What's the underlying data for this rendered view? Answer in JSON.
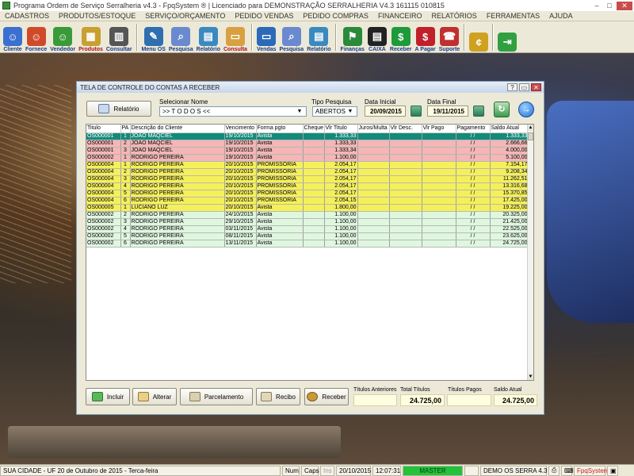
{
  "window": {
    "title": "Programa Ordem de Serviço Serralheria v4.3 - FpqSystem ® | Licenciado para  DEMONSTRAÇÃO SERRALHERIA V4.3 161115 010815"
  },
  "menu": [
    "CADASTROS",
    "PRODUTOS/ESTOQUE",
    "SERVIÇO/ORÇAMENTO",
    "PEDIDO VENDAS",
    "PEDIDO COMPRAS",
    "FINANCEIRO",
    "RELATÓRIOS",
    "FERRAMENTAS",
    "AJUDA"
  ],
  "toolbar": [
    {
      "label": "Cliente",
      "icon": "client-icon",
      "color": "#3b6fd0"
    },
    {
      "label": "Fornece",
      "icon": "supplier-icon",
      "color": "#d04a2a"
    },
    {
      "label": "Vendedor",
      "icon": "seller-icon",
      "color": "#3a9a3a"
    },
    {
      "label": "Produtos",
      "icon": "boxes-icon",
      "color": "#c8a030"
    },
    {
      "label": "Consultar",
      "icon": "barcode-icon",
      "color": "#555555"
    },
    {
      "label": "Menu OS",
      "icon": "clipboard-icon",
      "color": "#2f6fb0"
    },
    {
      "label": "Pesquisa",
      "icon": "search-doc-icon",
      "color": "#6a8ad0"
    },
    {
      "label": "Relatório",
      "icon": "report-icon",
      "color": "#3a8ac0"
    },
    {
      "label": "Consulta",
      "icon": "folder-icon",
      "color": "#d8a040"
    },
    {
      "label": "Vendas",
      "icon": "monitor-icon",
      "color": "#2a6ab8"
    },
    {
      "label": "Pesquisa",
      "icon": "search-doc-icon",
      "color": "#6a8ad0"
    },
    {
      "label": "Relatório",
      "icon": "report-icon",
      "color": "#3a8ac0"
    },
    {
      "label": "Finanças",
      "icon": "flags-icon",
      "color": "#2a8a3a"
    },
    {
      "label": "CAIXA",
      "icon": "cash-book-icon",
      "color": "#222222"
    },
    {
      "label": "Receber",
      "icon": "dollar-green-icon",
      "color": "#1f9a3a"
    },
    {
      "label": "A Pagar",
      "icon": "dollar-red-icon",
      "color": "#c0202a"
    },
    {
      "label": "Suporte",
      "icon": "support-icon",
      "color": "#c03030"
    },
    {
      "label": "",
      "icon": "coin-icon",
      "color": "#d0a020"
    },
    {
      "label": "",
      "icon": "exit-icon",
      "color": "#30a040"
    }
  ],
  "dialog": {
    "title": "TELA DE CONTROLE DO CONTAS A RECEBER",
    "report_button": "Relatório",
    "select_name_label": "Selecionar Nome",
    "select_name_value": ">> T O D O S <<",
    "tipo_label": "Tipo  Pesquisa",
    "tipo_value": "ABERTOS",
    "data_inicial_label": "Data Inicial",
    "data_inicial": "20/09/2015",
    "data_final_label": "Data Final",
    "data_final": "19/11/2015"
  },
  "grid": {
    "columns": [
      "Titulo",
      "PA",
      "Descrição do Cliente",
      "Vencimento",
      "Forma pgto",
      "Cheque",
      "Vlr Titulo",
      "Juros/Multa",
      "Vlr Desc.",
      "Vlr Pago",
      "Pagamento",
      "Saldo Atual"
    ],
    "rows": [
      {
        "style": "sel",
        "cells": [
          "OS000001",
          "1",
          "JOÃO MAQCIEL",
          "19/10/2015",
          "Avista",
          "",
          "1.333,33",
          "",
          "",
          "",
          "/ /",
          "1.333,33"
        ]
      },
      {
        "style": "r-pink",
        "cells": [
          "OS000001",
          "2",
          "JOÃO MAQCIEL",
          "19/10/2015",
          "Avista",
          "",
          "1.333,33",
          "",
          "",
          "",
          "/ /",
          "2.666,66"
        ]
      },
      {
        "style": "r-pink",
        "cells": [
          "OS000001",
          "3",
          "JOÃO MAQCIEL",
          "19/10/2015",
          "Avista",
          "",
          "1.333,34",
          "",
          "",
          "",
          "/ /",
          "4.000,00"
        ]
      },
      {
        "style": "r-pink",
        "cells": [
          "OS000002",
          "1",
          "RODRIGO PEREIRA",
          "19/10/2015",
          "Avista",
          "",
          "1.100,00",
          "",
          "",
          "",
          "/ /",
          "5.100,00"
        ]
      },
      {
        "style": "r-yellow",
        "cells": [
          "OS000004",
          "1",
          "RODRIGO PEREIRA",
          "20/10/2015",
          "PROMISSÓRIA",
          "",
          "2.054,17",
          "",
          "",
          "",
          "/ /",
          "7.154,17"
        ]
      },
      {
        "style": "r-yellow",
        "cells": [
          "OS000004",
          "2",
          "RODRIGO PEREIRA",
          "20/10/2015",
          "PROMISSÓRIA",
          "",
          "2.054,17",
          "",
          "",
          "",
          "/ /",
          "9.208,34"
        ]
      },
      {
        "style": "r-yellow",
        "cells": [
          "OS000004",
          "3",
          "RODRIGO PEREIRA",
          "20/10/2015",
          "PROMISSÓRIA",
          "",
          "2.054,17",
          "",
          "",
          "",
          "/ /",
          "11.262,51"
        ]
      },
      {
        "style": "r-yellow",
        "cells": [
          "OS000004",
          "4",
          "RODRIGO PEREIRA",
          "20/10/2015",
          "PROMISSÓRIA",
          "",
          "2.054,17",
          "",
          "",
          "",
          "/ /",
          "13.316,68"
        ]
      },
      {
        "style": "r-yellow",
        "cells": [
          "OS000004",
          "5",
          "RODRIGO PEREIRA",
          "20/10/2015",
          "PROMISSÓRIA",
          "",
          "2.054,17",
          "",
          "",
          "",
          "/ /",
          "15.370,85"
        ]
      },
      {
        "style": "r-yellow",
        "cells": [
          "OS000004",
          "6",
          "RODRIGO PEREIRA",
          "20/10/2015",
          "PROMISSÓRIA",
          "",
          "2.054,15",
          "",
          "",
          "",
          "/ /",
          "17.425,00"
        ]
      },
      {
        "style": "r-yellow",
        "cells": [
          "OS000005",
          "1",
          "LUCIANO LUZ",
          "20/10/2015",
          "Avista",
          "",
          "1.800,00",
          "",
          "",
          "",
          "/ /",
          "19.225,00"
        ]
      },
      {
        "style": "r-green",
        "cells": [
          "OS000002",
          "2",
          "RODRIGO PEREIRA",
          "24/10/2015",
          "Avista",
          "",
          "1.100,00",
          "",
          "",
          "",
          "/ /",
          "20.325,00"
        ]
      },
      {
        "style": "r-green",
        "cells": [
          "OS000002",
          "3",
          "RODRIGO PEREIRA",
          "29/10/2015",
          "Avista",
          "",
          "1.100,00",
          "",
          "",
          "",
          "/ /",
          "21.425,00"
        ]
      },
      {
        "style": "r-green",
        "cells": [
          "OS000002",
          "4",
          "RODRIGO PEREIRA",
          "03/11/2015",
          "Avista",
          "",
          "1.100,00",
          "",
          "",
          "",
          "/ /",
          "22.525,00"
        ]
      },
      {
        "style": "r-green",
        "cells": [
          "OS000002",
          "5",
          "RODRIGO PEREIRA",
          "08/11/2015",
          "Avista",
          "",
          "1.100,00",
          "",
          "",
          "",
          "/ /",
          "23.625,00"
        ]
      },
      {
        "style": "r-green",
        "cells": [
          "OS000002",
          "6",
          "RODRIGO PEREIRA",
          "13/11/2015",
          "Avista",
          "",
          "1.100,00",
          "",
          "",
          "",
          "/ /",
          "24.725,00"
        ]
      }
    ]
  },
  "actions": {
    "incluir": "Incluir",
    "alterar": "Alterar",
    "parcelamento": "Parcelamento",
    "recibo": "Recibo",
    "receber": "Receber"
  },
  "totals": {
    "anteriores_label": "Títulos Anteriores",
    "anteriores": "",
    "total_label": "Total Títulos",
    "total": "24.725,00",
    "pagos_label": "Títulos Pagos",
    "pagos": "",
    "saldo_label": "Saldo Atual",
    "saldo": "24.725,00"
  },
  "status": {
    "city": "SUA CIDADE - UF 20 de Outubro de 2015 - Terca-feira",
    "num": "Num",
    "caps": "Caps",
    "ins": "Ins",
    "date": "20/10/2015",
    "time": "12:07:31",
    "master": "MASTER",
    "version": "DEMO OS SERRA 4.3",
    "brand": "FpqSystem"
  },
  "colors": {
    "selected_row": "#138a7a",
    "pink_row": "#f4b6b6",
    "yellow_row": "#f5f05a",
    "green_row": "#dff7df",
    "master_green": "#22c23a"
  }
}
